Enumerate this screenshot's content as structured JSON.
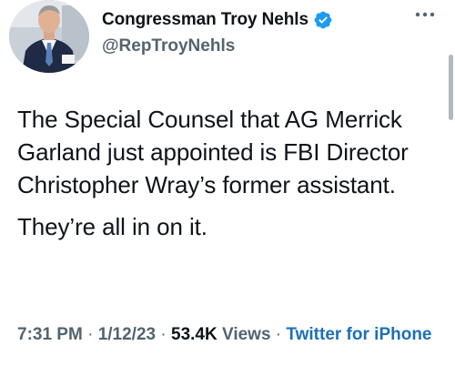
{
  "author": {
    "display_name": "Congressman Troy Nehls",
    "handle": "@RepTroyNehls",
    "avatar_icon": "person-avatar",
    "verified_icon": "verified-badge-icon",
    "verified_color": "#1d9bf0"
  },
  "menu": {
    "more_icon": "more-horizontal-icon"
  },
  "tweet": {
    "paragraphs": [
      "The Special Counsel that AG Merrick Garland just appointed is FBI Director Christopher Wray’s former assistant.",
      "They’re all in on it."
    ]
  },
  "meta": {
    "time": "7:31 PM",
    "separator": "·",
    "date": "1/12/23",
    "views_count": "53.4K",
    "views_label": "Views",
    "source": "Twitter for iPhone"
  },
  "colors": {
    "text_primary": "#0f1419",
    "text_secondary": "#536471",
    "link": "#1d6fb8"
  }
}
